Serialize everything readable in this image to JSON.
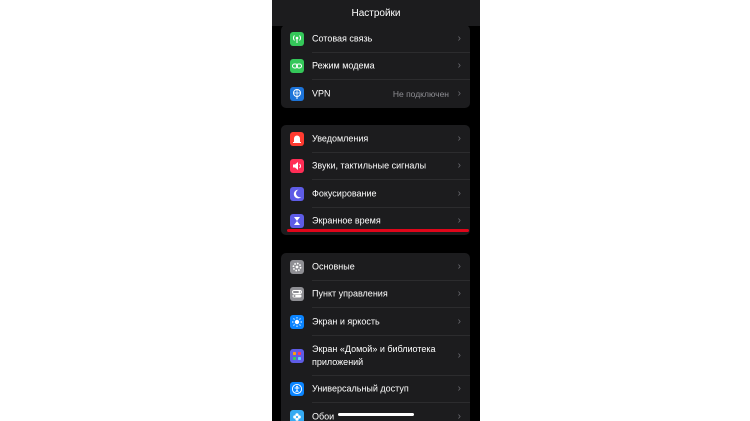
{
  "header": {
    "title": "Настройки"
  },
  "groups": [
    {
      "items": [
        {
          "label": "Сотовая связь",
          "value": "",
          "icon": "antenna-icon",
          "color": "#34c759"
        },
        {
          "label": "Режим модема",
          "value": "",
          "icon": "chain-link-icon",
          "color": "#34c759"
        },
        {
          "label": "VPN",
          "value": "Не подключен",
          "icon": "globe-icon",
          "color": "#1d74d9"
        }
      ]
    },
    {
      "items": [
        {
          "label": "Уведомления",
          "value": "",
          "icon": "bell-icon",
          "color": "#ff3b30"
        },
        {
          "label": "Звуки, тактильные сигналы",
          "value": "",
          "icon": "speaker-icon",
          "color": "#ff2d55"
        },
        {
          "label": "Фокусирование",
          "value": "",
          "icon": "moon-icon",
          "color": "#5e5ce6"
        },
        {
          "label": "Экранное время",
          "value": "",
          "icon": "hourglass-icon",
          "color": "#5e5ce6"
        }
      ]
    },
    {
      "items": [
        {
          "label": "Основные",
          "value": "",
          "icon": "gear-icon",
          "color": "#8e8e93"
        },
        {
          "label": "Пункт управления",
          "value": "",
          "icon": "toggles-icon",
          "color": "#8e8e93"
        },
        {
          "label": "Экран и яркость",
          "value": "",
          "icon": "sun-icon",
          "color": "#0a84ff"
        },
        {
          "label": "Экран «Домой» и библиотека приложений",
          "value": "",
          "icon": "app-grid-icon",
          "color": "#5e5ce6"
        },
        {
          "label": "Универсальный доступ",
          "value": "",
          "icon": "accessibility-icon",
          "color": "#0a84ff"
        },
        {
          "label": "Обои",
          "value": "",
          "icon": "flower-icon",
          "color": "#35aaf2"
        }
      ]
    }
  ],
  "colors": {
    "highlight": "#e0061a",
    "background": "#000000",
    "cell": "#1c1c1e"
  }
}
